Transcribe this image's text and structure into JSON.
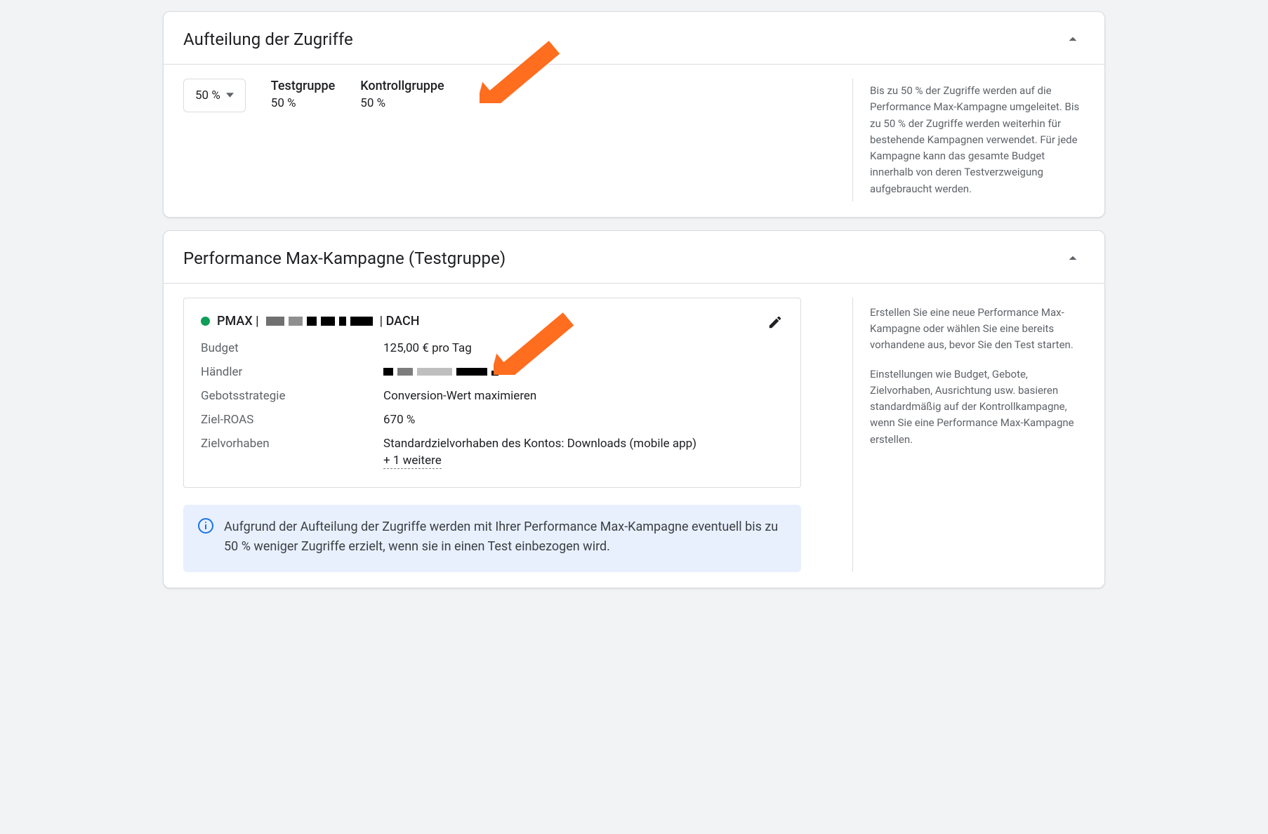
{
  "trafficSplit": {
    "title": "Aufteilung der Zugriffe",
    "selected": "50 %",
    "testGroup": {
      "label": "Testgruppe",
      "value": "50 %"
    },
    "controlGroup": {
      "label": "Kontrollgruppe",
      "value": "50 %"
    },
    "sideText": "Bis zu 50 % der Zugriffe werden auf die Performance Max-Kampagne umgeleitet. Bis zu 50 % der Zugriffe werden weiterhin für bestehende Kampagnen verwendet. Für jede Kampagne kann das gesamte Budget innerhalb von deren Testverzweigung aufgebraucht werden."
  },
  "pmax": {
    "title": "Performance Max-Kampagne (Testgruppe)",
    "campaign": {
      "namePrefix": "PMAX |",
      "nameSuffix": "| DACH",
      "budgetLabel": "Budget",
      "budget": "125,00 € pro Tag",
      "merchantLabel": "Händler",
      "bidStrategyLabel": "Gebotsstrategie",
      "bidStrategy": "Conversion-Wert maximieren",
      "targetRoasLabel": "Ziel-ROAS",
      "targetRoas": "670 %",
      "goalsLabel": "Zielvorhaben",
      "goals": "Standardzielvorhaben des Kontos: Downloads (mobile app)",
      "moreLink": "+ 1 weitere"
    },
    "sideText1": "Erstellen Sie eine neue Performance Max-Kampagne oder wählen Sie eine bereits vorhandene aus, bevor Sie den Test starten.",
    "sideText2": "Einstellungen wie Budget, Gebote, Zielvorhaben, Ausrichtung usw. basieren standardmäßig auf der Kontrollkampagne, wenn Sie eine Performance Max-Kampagne erstellen.",
    "info": "Aufgrund der Aufteilung der Zugriffe werden mit Ihrer Performance Max-Kampagne eventuell bis zu 50 % weniger Zugriffe erzielt, wenn sie in einen Test einbezogen wird."
  }
}
